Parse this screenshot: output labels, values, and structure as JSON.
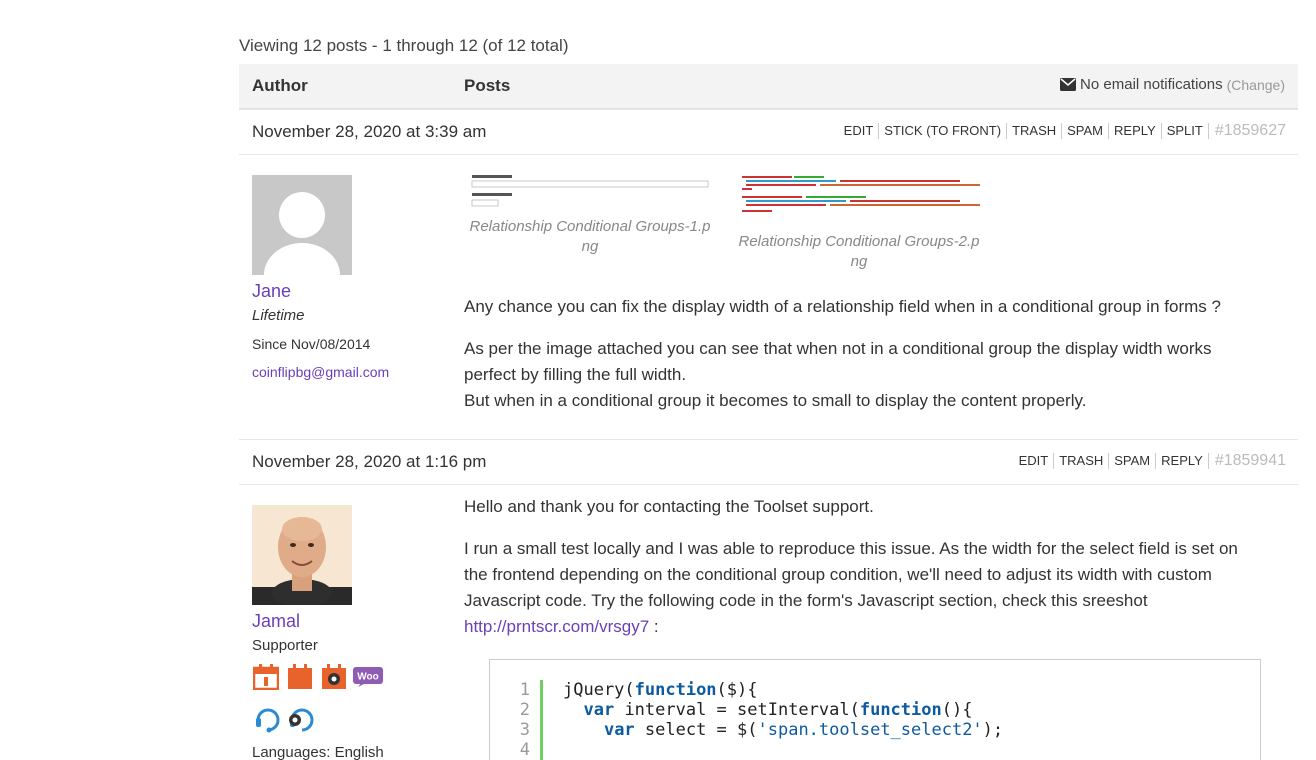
{
  "viewing": "Viewing 12 posts - 1 through 12 (of 12 total)",
  "header": {
    "author": "Author",
    "posts": "Posts",
    "notifications": "No email notifications",
    "change": "(Change)"
  },
  "posts": [
    {
      "date": "November 28, 2020 at 3:39 am",
      "actions": [
        "EDIT",
        "STICK (TO FRONT)",
        "TRASH",
        "SPAM",
        "REPLY",
        "SPLIT"
      ],
      "id": "#1859627",
      "author": {
        "name": "Jane",
        "role": "Lifetime",
        "since": "Since Nov/08/2014",
        "email": "coinflipbg@gmail.com"
      },
      "attachments": [
        {
          "line1": "Relationship Conditional Groups-1.p",
          "line2": "ng"
        },
        {
          "line1": "Relationship Conditional Groups-2.p",
          "line2": "ng"
        }
      ],
      "paragraphs": [
        "Any chance you can fix the display width of a relationship field when in a conditional group in forms ?",
        "As per the image attached you can see that when not in a conditional group the display width works perfect by filling the full width.",
        "But when in a conditional group it becomes to small to display the content properly."
      ]
    },
    {
      "date": "November 28, 2020 at 1:16 pm",
      "actions": [
        "EDIT",
        "TRASH",
        "SPAM",
        "REPLY"
      ],
      "id": "#1859941",
      "author": {
        "name": "Jamal",
        "role": "Supporter",
        "languages": "Languages: English"
      },
      "paragraphs": [
        "Hello and thank you for contacting the Toolset support.",
        "I run a small test locally and I was able to reproduce this issue. As the width for the select field is set on the frontend depending on the conditional group condition, we'll need to adjust its width with custom Javascript code. Try the following code in the form's Javascript section, check this sreeshot"
      ],
      "link": "http://prntscr.com/vrsgy7",
      "link_suffix": " :",
      "code_line_numbers": [
        "1",
        "2",
        "3",
        "4"
      ]
    }
  ],
  "colors": {
    "link": "#6a40b8",
    "badge_orange": "#e8622c",
    "badge_woo": "#8f5bb5",
    "badge_blue": "#2a8ad4",
    "code_bar": "#6ccf5e"
  },
  "icons": [
    "envelope-icon",
    "calendar-badge-icon",
    "views-badge-icon",
    "forms-badge-icon",
    "woo-badge-icon",
    "support-badge-icon",
    "support2-badge-icon"
  ]
}
